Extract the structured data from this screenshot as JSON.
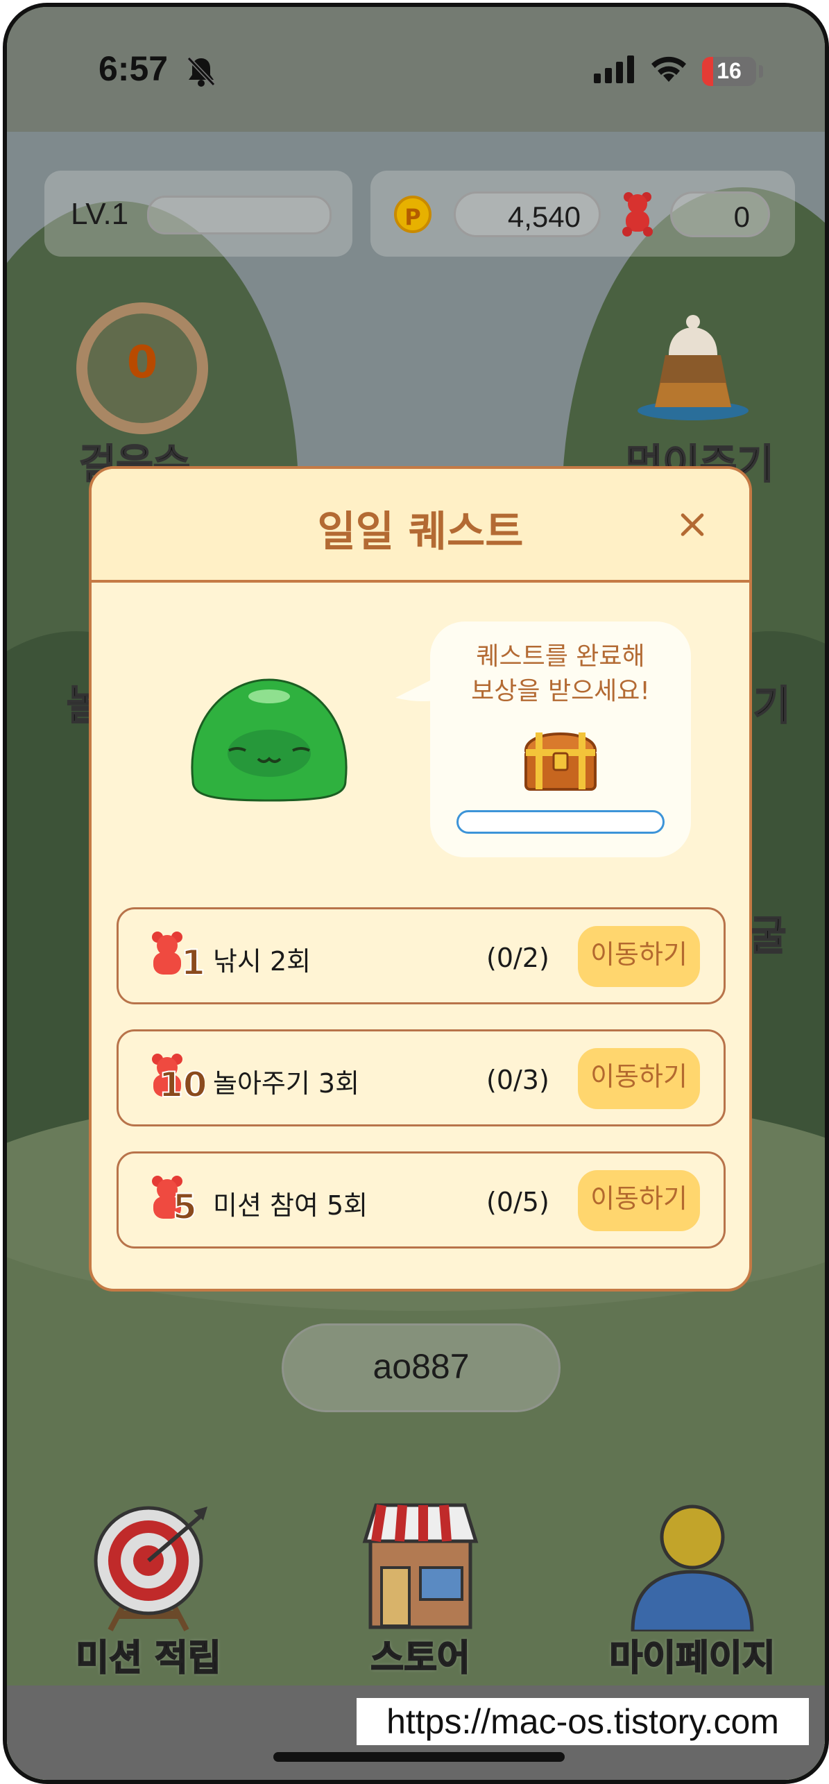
{
  "status_bar": {
    "time": "6:57",
    "battery": "16"
  },
  "hud": {
    "level": "LV.1",
    "points": "4,540",
    "jelly": "0"
  },
  "left_counter": {
    "value": "0",
    "label": "걸음수"
  },
  "right_items": {
    "feed_label": "먹이주기",
    "play_label": "기",
    "extra_label": "굴"
  },
  "left_partial_label": "놀",
  "modal": {
    "title": "일일 퀘스트",
    "bubble_text_line1": "퀘스트를 완료해",
    "bubble_text_line2": "보상을 받으세요!",
    "quests": [
      {
        "reward": "1",
        "label": "낚시 2회",
        "count": "(0/2)",
        "button": "이동하기"
      },
      {
        "reward": "10",
        "label": "놀아주기 3회",
        "count": "(0/3)",
        "button": "이동하기"
      },
      {
        "reward": "5",
        "label": "미션 참여 5회",
        "count": "(0/5)",
        "button": "이동하기"
      }
    ]
  },
  "username": "ao887",
  "nav": {
    "mission": "미션 적립",
    "store": "스토어",
    "mypage": "마이페이지"
  },
  "watermark": "https://mac-os.tistory.com",
  "colors": {
    "accent": "#b36a33",
    "button": "#ffd66e",
    "modal_bg": "#fff4d4",
    "slime": "#2fb13f"
  }
}
